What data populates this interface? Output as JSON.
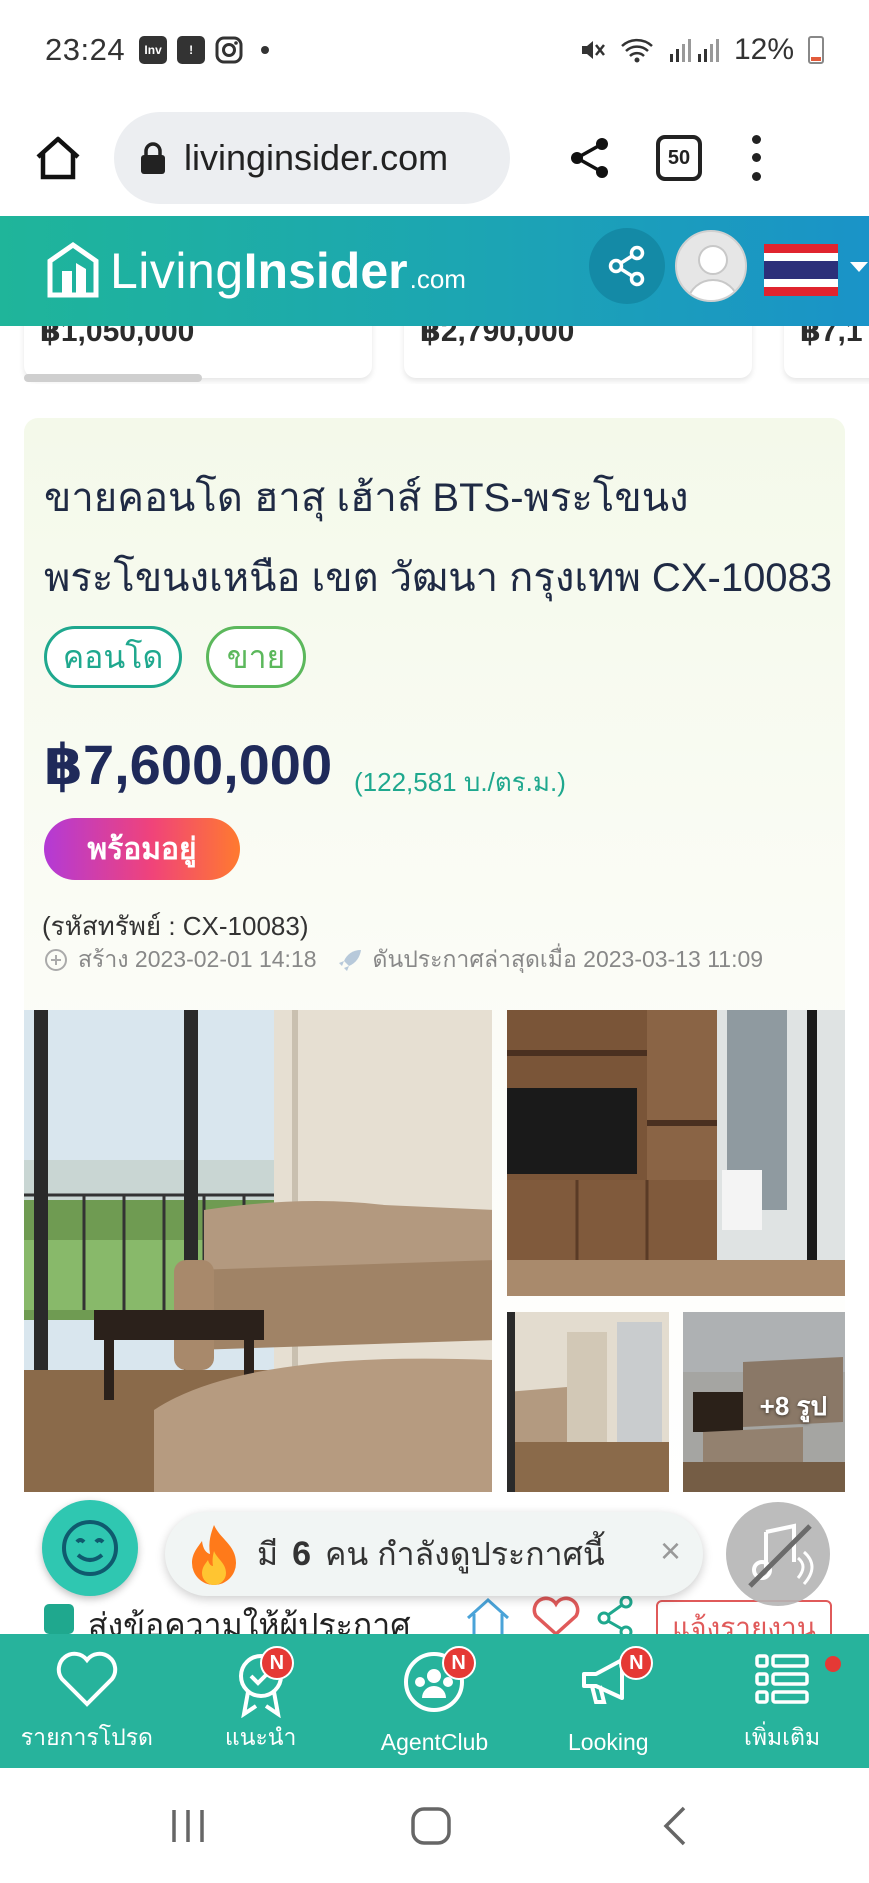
{
  "status_bar": {
    "time": "23:24",
    "app_badge": "Inv",
    "battery": "12%",
    "colors": {
      "battery_low": "#e25b3b"
    }
  },
  "browser": {
    "url": "livinginsider.com",
    "tab_count": "50"
  },
  "site_header": {
    "logo_word1": "Living",
    "logo_word2": "Insider",
    "logo_domain": ".com",
    "colors": {
      "gradient_start": "#1fb59a",
      "gradient_end": "#1a93c8"
    }
  },
  "carousel_prices": [
    "฿1,050,000",
    "฿2,790,000",
    "฿7,1"
  ],
  "listing": {
    "title": "ขายคอนโด ฮาสุ เฮ้าส์ BTS-พระโขนง พระโขนงเหนือ เขต วัฒนา กรุงเทพ CX-10083",
    "tags": [
      "คอนโด",
      "ขาย"
    ],
    "price": "฿7,600,000",
    "price_per_sqm": "(122,581 บ./ตร.ม.)",
    "ready_badge": "พร้อมอยู่",
    "property_code": "(รหัสทรัพย์ : CX-10083)",
    "created": "สร้าง 2023-02-01 14:18",
    "boosted": "ดันประกาศล่าสุดเมื่อ 2023-03-13 11:09",
    "more_photos": "+8 รูป"
  },
  "viewers": {
    "prefix": "มี",
    "count": "6",
    "suffix": "คน กำลังดูประกาศนี้",
    "close": "×"
  },
  "contact": {
    "label": "ส่งข้อความให้ผู้ประกาศ",
    "report": "แจ้งรายงาน"
  },
  "bottom_nav": [
    {
      "label": "รายการโปรด",
      "icon": "heart-icon",
      "badge": ""
    },
    {
      "label": "แนะนำ",
      "icon": "award-icon",
      "badge": "N"
    },
    {
      "label": "AgentClub",
      "icon": "agent-club-icon",
      "badge": "N"
    },
    {
      "label": "Looking",
      "icon": "megaphone-icon",
      "badge": "N"
    },
    {
      "label": "เพิ่มเติม",
      "icon": "menu-list-icon",
      "badge": ""
    }
  ]
}
